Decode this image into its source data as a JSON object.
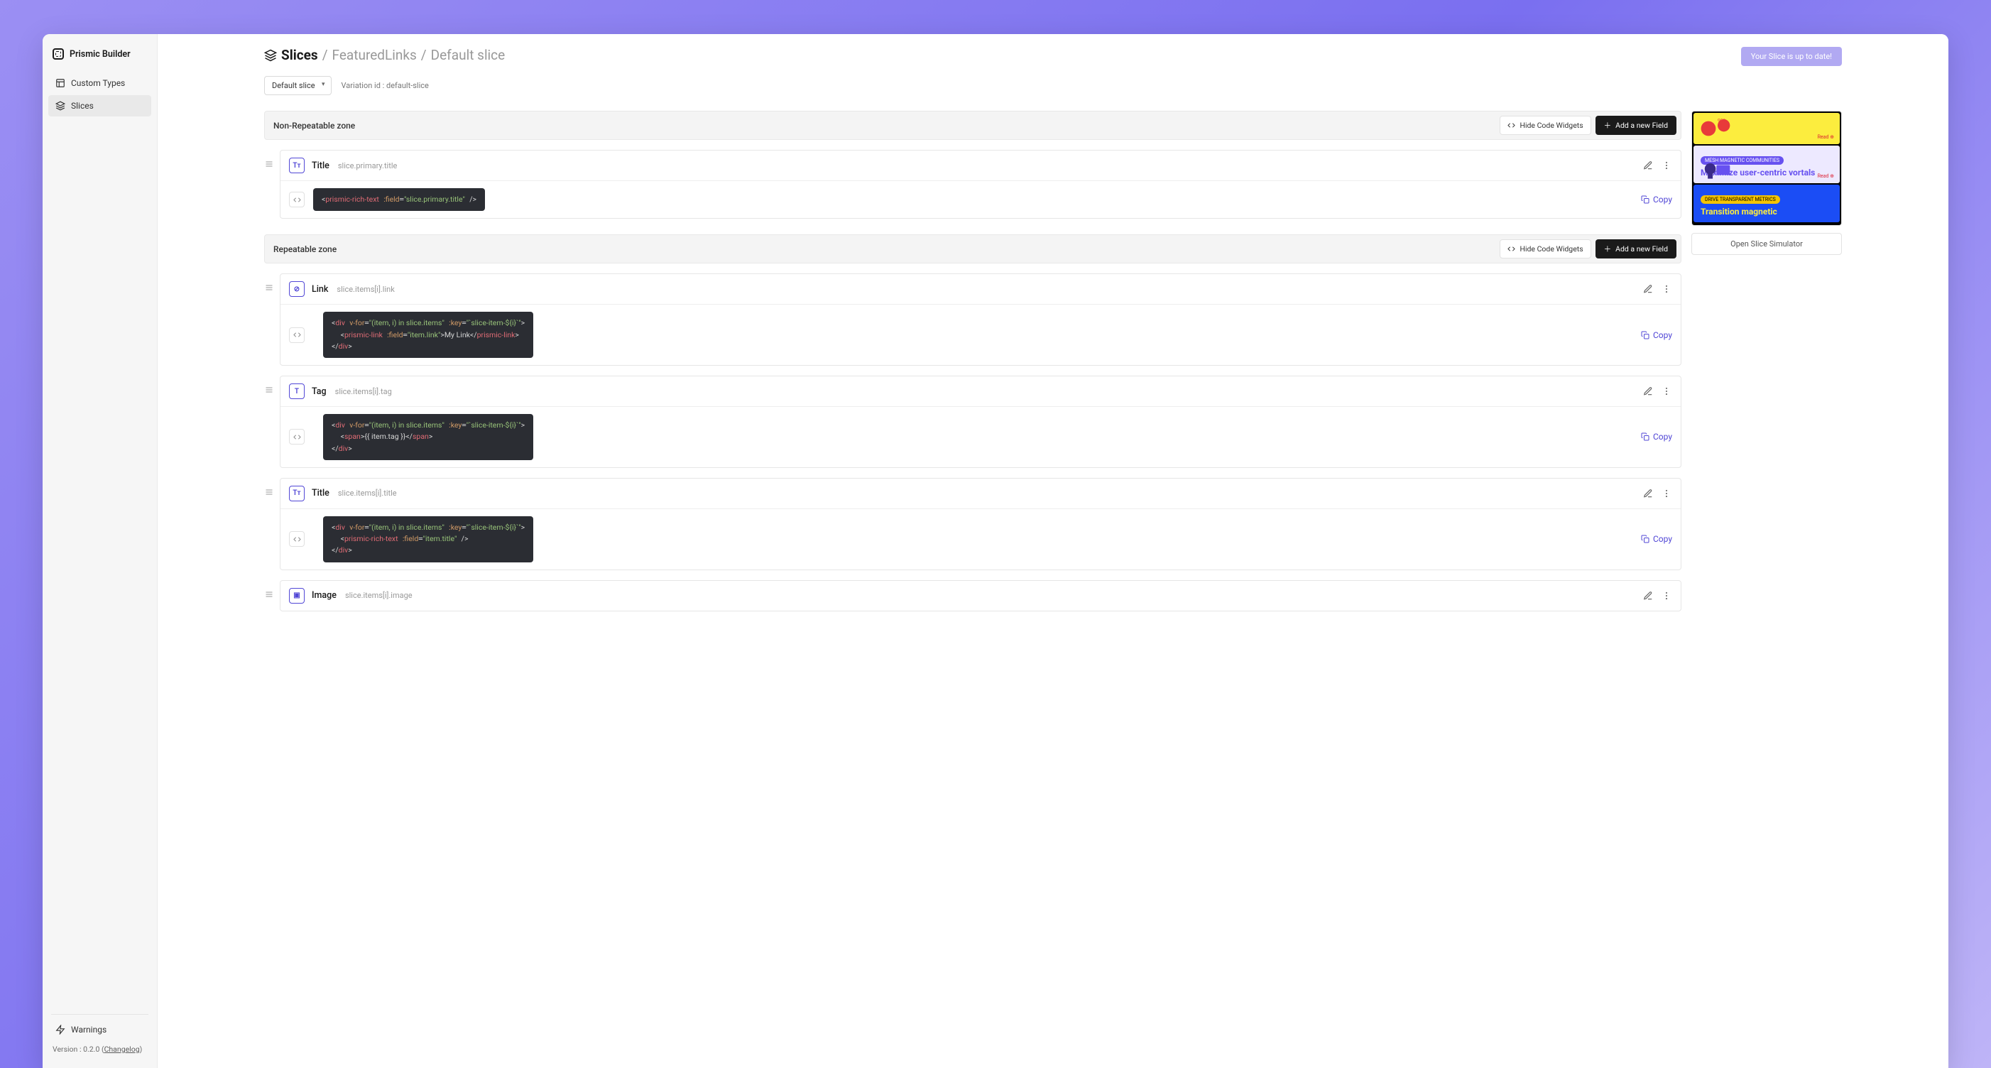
{
  "brand": "Prismic Builder",
  "sidebar": {
    "items": [
      {
        "label": "Custom Types",
        "icon": "layout-icon"
      },
      {
        "label": "Slices",
        "icon": "layers-icon"
      }
    ],
    "warnings_label": "Warnings",
    "version_prefix": "Version : ",
    "version": "0.2.0",
    "changelog_label": "Changelog"
  },
  "breadcrumb": {
    "root": "Slices",
    "slice": "FeaturedLinks",
    "variation": "Default slice"
  },
  "status_pill": "Your Slice is up to date!",
  "variation": {
    "selected": "Default slice",
    "id_label": "Variation id : default-slice"
  },
  "zones": {
    "non_repeat_label": "Non-Repeatable zone",
    "repeat_label": "Repeatable zone",
    "hide_code_label": "Hide Code Widgets",
    "add_field_label": "Add a new Field"
  },
  "copy_label": "Copy",
  "fields_non_repeat": [
    {
      "icon": "Tт",
      "name": "Title",
      "api_id": "slice.primary.title",
      "code_html": "<span class='t-txt'>&lt;</span><span class='t-tag'>prismic-rich-text</span> <span class='t-attr'>:field</span>=<span class='t-str'>\"slice.primary.title\"</span> <span class='t-txt'>/&gt;</span>"
    }
  ],
  "fields_repeat": [
    {
      "icon": "⊘",
      "name": "Link",
      "api_id": "slice.items[i].link",
      "code_html": "<span class='t-txt'>&lt;</span><span class='t-tag'>div</span> <span class='t-attr'>v-for</span>=<span class='t-str'>\"(item, i) in slice.items\"</span> <span class='t-attr'>:key</span>=<span class='t-str'>\"`slice-item-${i}`\"</span><span class='t-txt'>&gt;</span>\n  <span class='t-txt'>&lt;</span><span class='t-tag'>prismic-link</span> <span class='t-attr'>:field</span>=<span class='t-str'>\"item.link\"</span><span class='t-txt'>&gt;My Link&lt;/</span><span class='t-tag'>prismic-link</span><span class='t-txt'>&gt;</span>\n<span class='t-txt'>&lt;/</span><span class='t-tag'>div</span><span class='t-txt'>&gt;</span>"
    },
    {
      "icon": "T",
      "name": "Tag",
      "api_id": "slice.items[i].tag",
      "code_html": "<span class='t-txt'>&lt;</span><span class='t-tag'>div</span> <span class='t-attr'>v-for</span>=<span class='t-str'>\"(item, i) in slice.items\"</span> <span class='t-attr'>:key</span>=<span class='t-str'>\"`slice-item-${i}`\"</span><span class='t-txt'>&gt;</span>\n  <span class='t-txt'>&lt;</span><span class='t-tag'>span</span><span class='t-txt'>&gt;{{ item.tag }}&lt;/</span><span class='t-tag'>span</span><span class='t-txt'>&gt;</span>\n<span class='t-txt'>&lt;/</span><span class='t-tag'>div</span><span class='t-txt'>&gt;</span>"
    },
    {
      "icon": "Tт",
      "name": "Title",
      "api_id": "slice.items[i].title",
      "code_html": "<span class='t-txt'>&lt;</span><span class='t-tag'>div</span> <span class='t-attr'>v-for</span>=<span class='t-str'>\"(item, i) in slice.items\"</span> <span class='t-attr'>:key</span>=<span class='t-str'>\"`slice-item-${i}`\"</span><span class='t-txt'>&gt;</span>\n  <span class='t-txt'>&lt;</span><span class='t-tag'>prismic-rich-text</span> <span class='t-attr'>:field</span>=<span class='t-str'>\"item.title\"</span> <span class='t-txt'>/&gt;</span>\n<span class='t-txt'>&lt;/</span><span class='t-tag'>div</span><span class='t-txt'>&gt;</span>"
    },
    {
      "icon": "▣",
      "name": "Image",
      "api_id": "slice.items[i].image",
      "code_html": ""
    }
  ],
  "preview": {
    "cards": [
      {
        "bg": "pv-yellow",
        "tag": "",
        "title": "",
        "read": "Read ⊕"
      },
      {
        "bg": "pv-light",
        "tag": "MESH MAGNETIC COMMUNITIES",
        "title": "Maximize user-centric vortals",
        "read": "Read ⊕"
      },
      {
        "bg": "pv-blue",
        "tag": "DRIVE TRANSPARENT METRICS",
        "title": "Transition magnetic",
        "read": ""
      }
    ],
    "simulator_label": "Open Slice Simulator"
  }
}
